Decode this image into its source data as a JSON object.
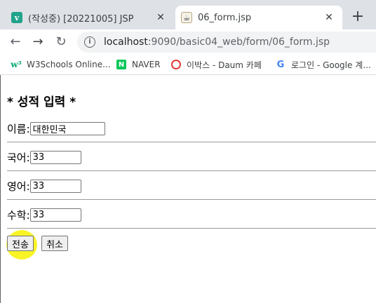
{
  "tabs": [
    {
      "title": "(작성중) [20221005] JSP",
      "icon": "velog-icon"
    },
    {
      "title": "06_form.jsp",
      "icon": "jsp-file-icon"
    }
  ],
  "new_tab": "+",
  "address": {
    "host": "localhost",
    "path": ":9090/basic04_web/form/06_form.jsp"
  },
  "bookmarks": [
    {
      "label": "W3Schools Online...",
      "icon": "w3schools-icon"
    },
    {
      "label": "NAVER",
      "icon": "naver-icon"
    },
    {
      "label": "이박스 - Daum 카페",
      "icon": "daum-icon"
    },
    {
      "label": "로그인 - Google 계...",
      "icon": "google-icon"
    }
  ],
  "page": {
    "heading": "* 성적 입력 *",
    "fields": [
      {
        "label": "이름:",
        "value": "대한민국"
      },
      {
        "label": "국어:",
        "value": "33"
      },
      {
        "label": "영어:",
        "value": "33"
      },
      {
        "label": "수학:",
        "value": "33"
      }
    ],
    "submit_label": "전송",
    "reset_label": "취소"
  },
  "colors": {
    "highlight": "#f7f200",
    "tabstrip": "#dee1e6"
  }
}
